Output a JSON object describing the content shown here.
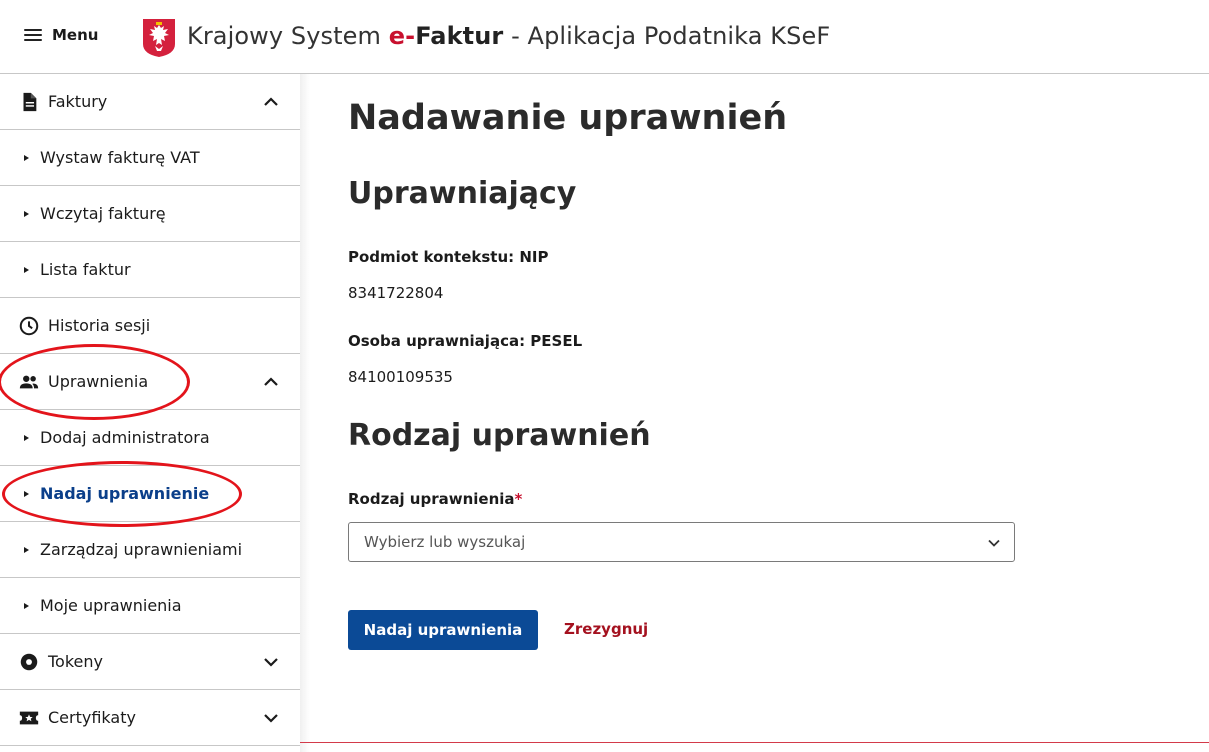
{
  "header": {
    "menu_label": "Menu",
    "title_prefix": "Krajowy System ",
    "title_e": "e-",
    "title_faktur": "Faktur",
    "title_suffix": " - Aplikacja Podatnika KSeF"
  },
  "sidebar": {
    "items": [
      {
        "label": "Faktury",
        "icon": "document-icon",
        "expanded": true
      },
      {
        "label": "Wystaw fakturę VAT"
      },
      {
        "label": "Wczytaj fakturę"
      },
      {
        "label": "Lista faktur"
      },
      {
        "label": "Historia sesji",
        "icon": "clock-icon"
      },
      {
        "label": "Uprawnienia",
        "icon": "people-icon",
        "expanded": true
      },
      {
        "label": "Dodaj administratora"
      },
      {
        "label": "Nadaj uprawnienie",
        "active": true
      },
      {
        "label": "Zarządzaj uprawnieniami"
      },
      {
        "label": "Moje uprawnienia"
      },
      {
        "label": "Tokeny",
        "icon": "token-icon",
        "expanded": false
      },
      {
        "label": "Certyfikaty",
        "icon": "certificate-icon",
        "expanded": false
      }
    ]
  },
  "main": {
    "page_title": "Nadawanie uprawnień",
    "section_grantor": "Uprawniający",
    "context_label": "Podmiot kontekstu: NIP",
    "context_value": "8341722804",
    "person_label": "Osoba uprawniająca: PESEL",
    "person_value": "84100109535",
    "section_type": "Rodzaj uprawnień",
    "type_field_label": "Rodzaj uprawnienia",
    "type_required_mark": "*",
    "type_placeholder": "Wybierz lub wyszukaj",
    "submit_label": "Nadaj uprawnienia",
    "cancel_label": "Zrezygnuj"
  },
  "colors": {
    "primary": "#0b4a96",
    "active_nav": "#0b3f8a",
    "cancel": "#a4111f",
    "annotation": "#e3141b"
  }
}
